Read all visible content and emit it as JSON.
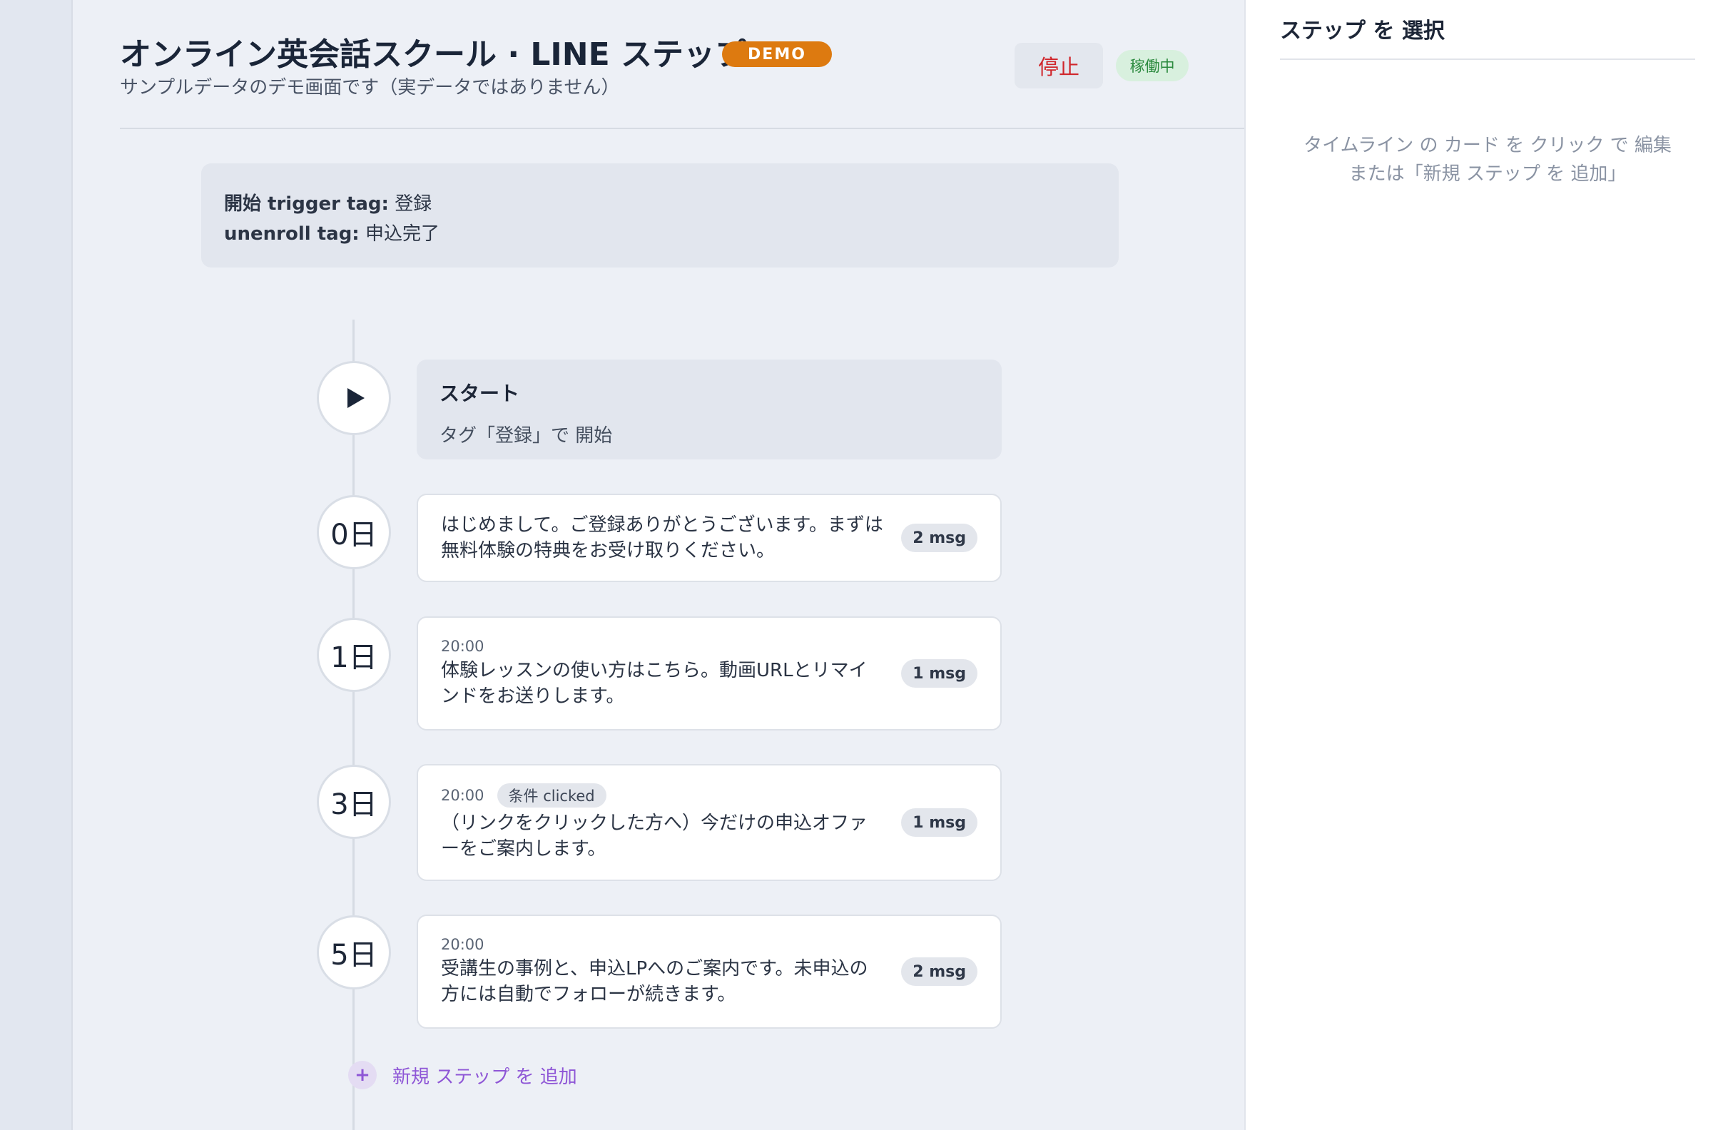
{
  "header": {
    "title": "オンライン英会話スクール · LINE ステップ",
    "demo_badge": "DEMO",
    "subtitle": "サンプルデータのデモ画面です（実データではありません）",
    "stop_label": "停止",
    "status_label": "稼働中"
  },
  "trigger": {
    "start_key": "開始 trigger tag:",
    "start_value": "登録",
    "unenroll_key": "unenroll tag:",
    "unenroll_value": "申込完了"
  },
  "timeline": {
    "start": {
      "title": "スタート",
      "description": "タグ「登録」で 開始"
    },
    "steps": [
      {
        "day": "0日",
        "time": "",
        "condition": "",
        "text": "はじめまして。ご登録ありがとうございます。まずは無料体験の特典をお受け取りください。",
        "msg_count": "2 msg"
      },
      {
        "day": "1日",
        "time": "20:00",
        "condition": "",
        "text": "体験レッスンの使い方はこちら。動画URLとリマインドをお送りします。",
        "msg_count": "1 msg"
      },
      {
        "day": "3日",
        "time": "20:00",
        "condition": "条件 clicked",
        "text": "（リンクをクリックした方へ）今だけの申込オファーをご案内します。",
        "msg_count": "1 msg"
      },
      {
        "day": "5日",
        "time": "20:00",
        "condition": "",
        "text": "受講生の事例と、申込LPへのご案内です。未申込の方には自動でフォローが続きます。",
        "msg_count": "2 msg"
      }
    ],
    "add_step_label": "新規 ステップ を 追加"
  },
  "panel": {
    "title": "ステップ を 選択",
    "hint_line1": "タイムライン の カード を クリック で 編集",
    "hint_line2": "または「新規 ステップ を 追加」"
  },
  "colors": {
    "accent_orange": "#dd7a10",
    "stop_red": "#d0262b",
    "status_green": "#2b8a3e",
    "add_purple": "#8e56d6"
  },
  "icons": {
    "start_node": "play-icon",
    "add_step": "plus-icon"
  }
}
